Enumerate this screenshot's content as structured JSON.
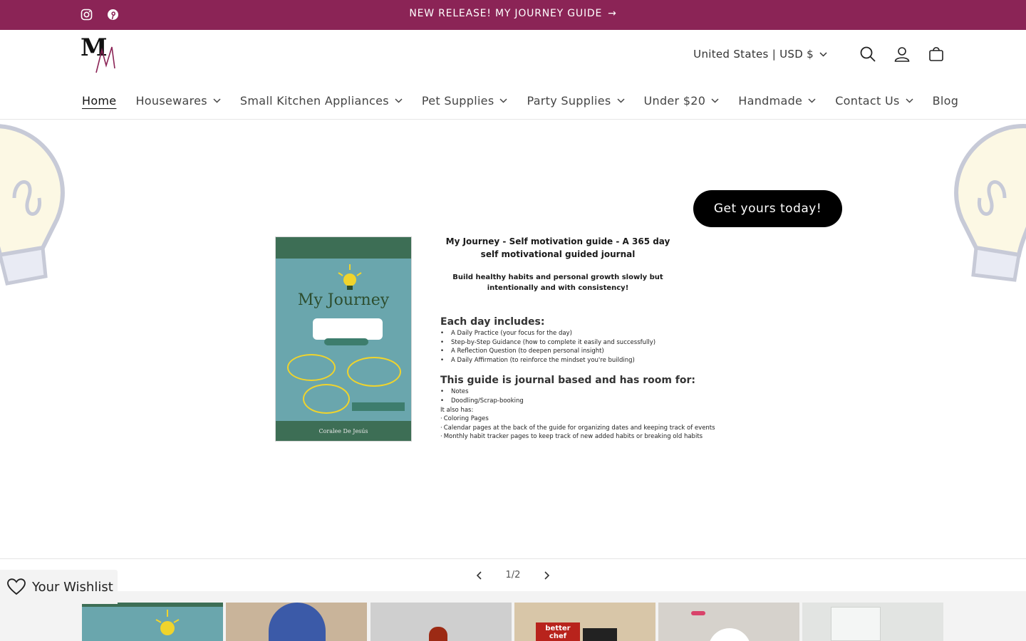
{
  "announcement": {
    "message": "NEW RELEASE! MY JOURNEY GUIDE",
    "arrow": "→",
    "social_icons": [
      "instagram-icon",
      "pinterest-icon"
    ],
    "bg_color": "#8b2456"
  },
  "header": {
    "logo_text": "MM",
    "currency": "United States | USD $",
    "icons": [
      "search-icon",
      "account-icon",
      "cart-icon"
    ]
  },
  "nav": {
    "items": [
      {
        "label": "Home",
        "active": true,
        "dropdown": false
      },
      {
        "label": "Housewares",
        "dropdown": true
      },
      {
        "label": "Small Kitchen Appliances",
        "dropdown": true
      },
      {
        "label": "Pet Supplies",
        "dropdown": true
      },
      {
        "label": "Party Supplies",
        "dropdown": true
      },
      {
        "label": "Under $20",
        "dropdown": true
      },
      {
        "label": "Handmade",
        "dropdown": true
      },
      {
        "label": "Contact Us",
        "dropdown": true
      },
      {
        "label": "Blog",
        "dropdown": false
      }
    ]
  },
  "hero": {
    "cta_label": "Get yours today!",
    "book": {
      "title": "My Journey",
      "author": "Coralee De Jesús"
    },
    "info": {
      "heading": "My Journey - Self motivation guide - A 365 day self motivational guided journal",
      "subheading": "Build healthy habits and personal growth slowly but intentionally and with consistency!",
      "section1_title": "Each day includes:",
      "section1_items": [
        "A Daily Practice (your focus for the day)",
        "Step-by-Step Guidance (how to complete it easily and successfully)",
        "A Reflection Question (to deepen personal insight)",
        "A Daily Affirmation (to reinforce the mindset you're building)"
      ],
      "section2_title": "This guide is journal based and has room for:",
      "section2_items": [
        "Notes",
        "Doodling/Scrap-booking"
      ],
      "also_label": "It also has:",
      "also_items": [
        "Coloring Pages",
        "Calendar pages at the back of the guide for organizing dates and keeping track of events",
        "Monthly habit tracker pages to keep track of new added habits or breaking old habits"
      ]
    }
  },
  "slider": {
    "counter": "1/2",
    "prev_icon": "chevron-left-icon",
    "next_icon": "chevron-right-icon"
  },
  "wishlist": {
    "label": "Your Wishlist",
    "icon": "heart-icon"
  },
  "thumbnails": [
    {
      "name": "my-journey-thumb",
      "color": "#6aa6ad"
    },
    {
      "name": "glove-thumb",
      "color": "#c9b49a"
    },
    {
      "name": "marble-thumb",
      "color": "#cfcfcf"
    },
    {
      "name": "better-chef-thumb",
      "color": "#d8c6a8",
      "text": "better chef"
    },
    {
      "name": "party-thumb",
      "color": "#d6d2cc"
    },
    {
      "name": "window-thumb",
      "color": "#e2e4e2"
    }
  ]
}
